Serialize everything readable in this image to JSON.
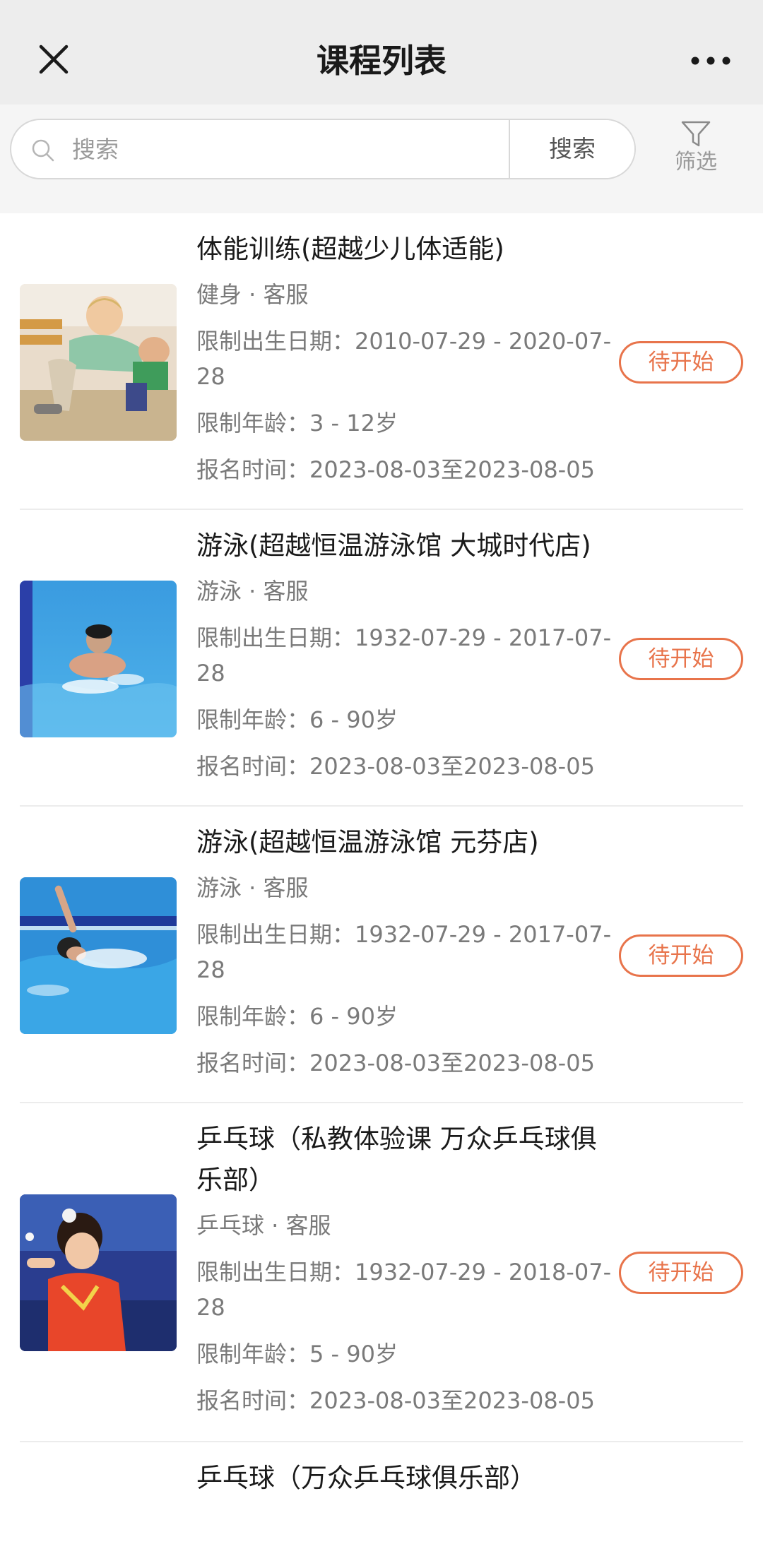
{
  "navbar": {
    "title": "课程列表",
    "close_icon": "close-icon",
    "more_icon": "more-dots-icon"
  },
  "search": {
    "placeholder": "搜索",
    "button_label": "搜索",
    "filter_label": "筛选"
  },
  "colors": {
    "accent": "#e8744b",
    "nav_bg": "#ededed",
    "search_bg": "#f5f5f5"
  },
  "courses": [
    {
      "title": "体能训练(超越少儿体适能)",
      "category": "健身 · 客服",
      "birth_limit": "限制出生日期：2010-07-29 - 2020-07-28",
      "age_limit": "限制年龄：3 - 12岁",
      "signup_time": "报名时间：2023-08-03至2023-08-05",
      "status": "待开始"
    },
    {
      "title": "游泳(超越恒温游泳馆 大城时代店)",
      "category": "游泳 · 客服",
      "birth_limit": "限制出生日期：1932-07-29 - 2017-07-28",
      "age_limit": "限制年龄：6 - 90岁",
      "signup_time": "报名时间：2023-08-03至2023-08-05",
      "status": "待开始"
    },
    {
      "title": "游泳(超越恒温游泳馆 元芬店)",
      "category": "游泳 · 客服",
      "birth_limit": "限制出生日期：1932-07-29 - 2017-07-28",
      "age_limit": "限制年龄：6 - 90岁",
      "signup_time": "报名时间：2023-08-03至2023-08-05",
      "status": "待开始"
    },
    {
      "title": "乒乓球（私教体验课 万众乒乓球俱乐部）",
      "category": "乒乓球 · 客服",
      "birth_limit": "限制出生日期：1932-07-29 - 2018-07-28",
      "age_limit": "限制年龄：5 - 90岁",
      "signup_time": "报名时间：2023-08-03至2023-08-05",
      "status": "待开始"
    },
    {
      "title": "乒乓球（万众乒乓球俱乐部）"
    }
  ]
}
